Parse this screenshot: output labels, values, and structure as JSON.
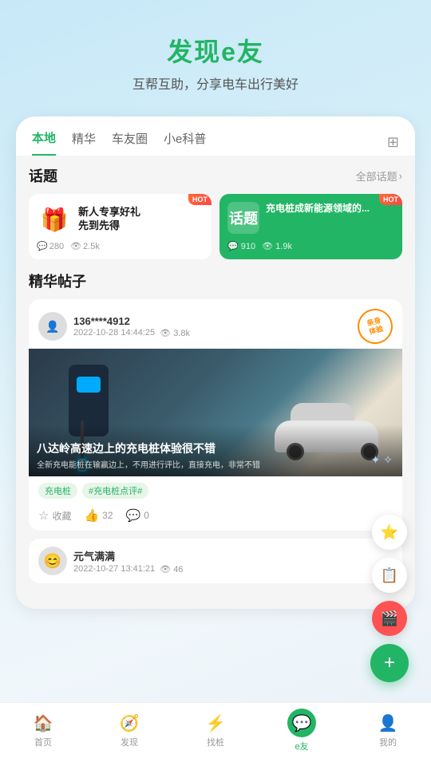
{
  "header": {
    "title_part1": "发现",
    "title_part2": "e友",
    "subtitle": "互帮互助，分享电车出行美好"
  },
  "tabs": {
    "items": [
      {
        "label": "本地",
        "active": true
      },
      {
        "label": "精华",
        "active": false
      },
      {
        "label": "车友圈",
        "active": false
      },
      {
        "label": "小e科普",
        "active": false
      }
    ],
    "grid_icon": "⊞"
  },
  "topics": {
    "section_title": "话题",
    "more_label": "全部话题",
    "items": [
      {
        "title_line1": "新人专享好礼",
        "title_line2": "先到先得",
        "comments": "280",
        "views": "2.5k",
        "hot": true,
        "type": "gift"
      },
      {
        "title": "充电桩成新能源领域的...",
        "label": "话题",
        "comments": "910",
        "views": "1.9k",
        "hot": true,
        "type": "green"
      }
    ]
  },
  "posts": {
    "section_title": "精华帖子",
    "items": [
      {
        "author": "136****4912",
        "date": "2022-10-28 14:44:25",
        "views": "3.8k",
        "stamp": "亲身\n体验",
        "image_title": "八达岭高速边上的充电桩体验很不错",
        "image_desc": "全新充电能桩在输赢边上，不用进行评比，直接充电，非常不错",
        "tags": [
          "充电桩",
          "#充电桩点评#"
        ],
        "collect": "收藏",
        "likes": "32",
        "comments": "0"
      },
      {
        "author": "元气满满",
        "date": "2022-10-27 13:41:21",
        "views": "46"
      }
    ]
  },
  "fab": {
    "star_icon": "☆",
    "edit_icon": "📋",
    "video_icon": "🎬",
    "add_icon": "+"
  },
  "bottom_nav": {
    "items": [
      {
        "label": "首页",
        "icon": "🏠",
        "active": false
      },
      {
        "label": "发现",
        "icon": "🧭",
        "active": false
      },
      {
        "label": "找桩",
        "icon": "⚡",
        "active": false
      },
      {
        "label": "e友",
        "icon": "💬",
        "active": true
      },
      {
        "label": "我的",
        "icon": "👤",
        "active": false
      }
    ]
  }
}
